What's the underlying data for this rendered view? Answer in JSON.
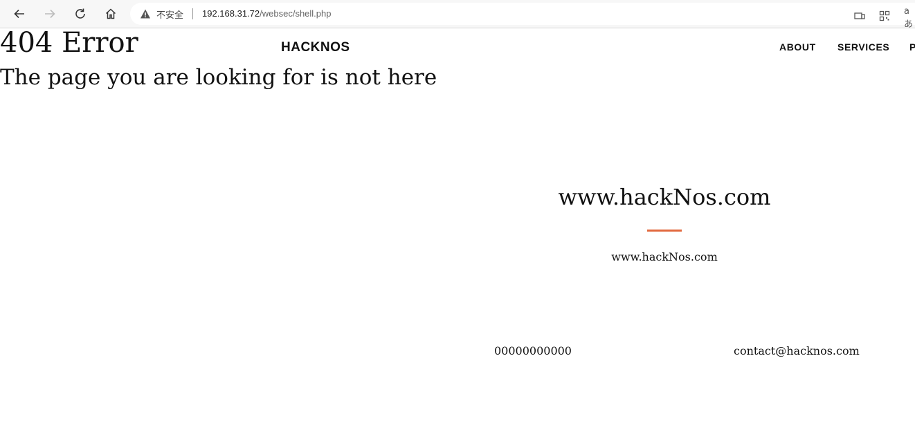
{
  "browser": {
    "security_label": "不安全",
    "url_host": "192.168.31.72",
    "url_path": "/websec/shell.php",
    "right_text": "aあ"
  },
  "page": {
    "error_title": "404 Error",
    "error_subtitle": "The page you are looking for is not here",
    "brand": "HACKNOS",
    "nav": [
      "ABOUT",
      "SERVICES",
      "P"
    ],
    "hero_title": "www.hackNos.com",
    "hero_subtitle": "www.hackNos.com",
    "phone": "00000000000",
    "email": "contact@hacknos.com",
    "accent_color": "#e2693f"
  }
}
